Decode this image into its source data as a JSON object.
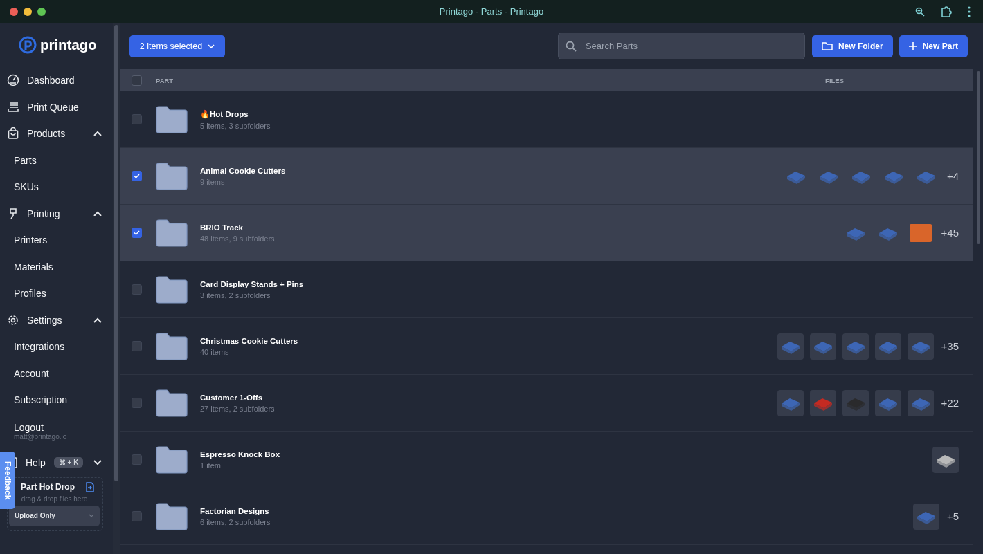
{
  "window": {
    "title": "Printago - Parts - Printago"
  },
  "sidebar": {
    "logo": "printago",
    "items": [
      {
        "label": "Dashboard"
      },
      {
        "label": "Print Queue"
      },
      {
        "label": "Products",
        "expanded": true,
        "children": [
          {
            "label": "Parts"
          },
          {
            "label": "SKUs"
          }
        ]
      },
      {
        "label": "Printing",
        "expanded": true,
        "children": [
          {
            "label": "Printers"
          },
          {
            "label": "Materials"
          },
          {
            "label": "Profiles"
          }
        ]
      },
      {
        "label": "Settings",
        "expanded": true,
        "children": [
          {
            "label": "Integrations"
          },
          {
            "label": "Account"
          },
          {
            "label": "Subscription"
          }
        ]
      }
    ],
    "logout": {
      "label": "Logout",
      "email": "matt@printago.io"
    },
    "help": {
      "label": "Help",
      "shortcut": "⌘ + K",
      "expanded": false
    },
    "hot_drop": {
      "title": "Part Hot Drop",
      "hint": "drag & drop files here",
      "mode": "Upload Only"
    },
    "feedback": "Feedback"
  },
  "toolbar": {
    "selection": "2 items selected",
    "search": {
      "placeholder": "Search Parts"
    },
    "buttons": [
      "New Folder",
      "New Part"
    ]
  },
  "table": {
    "columns": [
      "PART",
      "FILES"
    ],
    "all_checked": false,
    "rows": [
      {
        "name": "Hot Drops",
        "emoji": "🔥",
        "meta": "5 items, 3 subfolders",
        "selected": false
      },
      {
        "name": "Animal Cookie Cutters",
        "meta": "9 items",
        "selected": true,
        "framed": false,
        "thumbs": [
          {
            "kind": "model",
            "color": "#3d66b5"
          },
          {
            "kind": "model",
            "color": "#3d66b5"
          },
          {
            "kind": "model",
            "color": "#3d66b5"
          },
          {
            "kind": "model",
            "color": "#3d66b5"
          },
          {
            "kind": "model",
            "color": "#3d66b5"
          }
        ],
        "more": "+4"
      },
      {
        "name": "BRIO Track",
        "meta": "48 items, 9 subfolders",
        "selected": true,
        "framed": false,
        "thumbs": [
          {
            "kind": "model",
            "color": "#3d66b5"
          },
          {
            "kind": "model",
            "color": "#3d66b5"
          },
          {
            "kind": "photo",
            "color": "#d9652a"
          }
        ],
        "more": "+45"
      },
      {
        "name": "Card Display Stands + Pins",
        "meta": "3 items, 2 subfolders",
        "selected": false
      },
      {
        "name": "Christmas Cookie Cutters",
        "meta": "40 items",
        "selected": false,
        "framed": true,
        "thumbs": [
          {
            "kind": "model",
            "color": "#3d66b5"
          },
          {
            "kind": "model",
            "color": "#3d66b5"
          },
          {
            "kind": "model",
            "color": "#3d66b5"
          },
          {
            "kind": "model",
            "color": "#3d66b5"
          },
          {
            "kind": "model",
            "color": "#3d66b5"
          }
        ],
        "more": "+35"
      },
      {
        "name": "Customer 1-Offs",
        "meta": "27 items, 2 subfolders",
        "selected": false,
        "framed": true,
        "thumbs": [
          {
            "kind": "model",
            "color": "#3d66b5"
          },
          {
            "kind": "model",
            "color": "#c42a22"
          },
          {
            "kind": "model",
            "color": "#2a2a2c"
          },
          {
            "kind": "model",
            "color": "#3d66b5"
          },
          {
            "kind": "model",
            "color": "#3d66b5"
          }
        ],
        "more": "+22"
      },
      {
        "name": "Espresso Knock Box",
        "meta": "1 item",
        "selected": false,
        "framed": true,
        "thumbs": [
          {
            "kind": "model",
            "color": "#b9b9b9"
          }
        ]
      },
      {
        "name": "Factorian Designs",
        "meta": "6 items, 2 subfolders",
        "selected": false,
        "framed": true,
        "thumbs": [
          {
            "kind": "model",
            "color": "#3d66b5"
          }
        ],
        "more": "+5"
      }
    ]
  }
}
